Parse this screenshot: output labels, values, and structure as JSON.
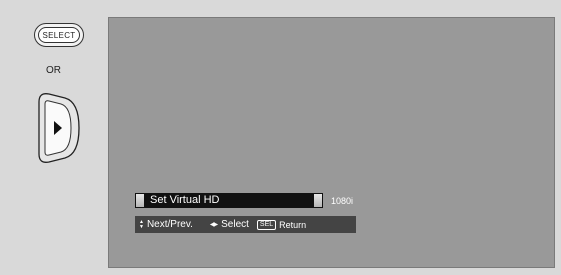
{
  "remote": {
    "select_button_label": "SELECT",
    "or_label": "OR",
    "dpad_icon": "right-arrow-icon"
  },
  "osd": {
    "menu": {
      "label": "Set Virtual HD",
      "value": "1080i"
    },
    "help": {
      "next_prev_label": "Next/Prev.",
      "select_label": "Select",
      "sel_badge": "SEL",
      "return_label": "Return"
    }
  },
  "colors": {
    "screen_bg": "#999999",
    "menu_bar": "#111111",
    "help_bar": "#444444",
    "page_bg": "#d9d9d9"
  }
}
